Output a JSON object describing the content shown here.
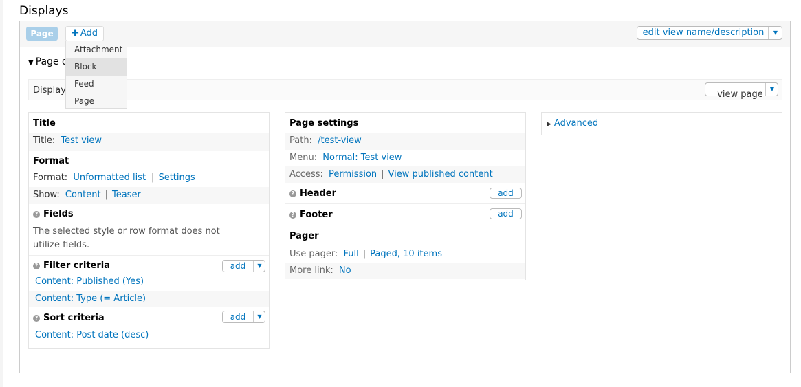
{
  "page": {
    "title": "Displays"
  },
  "tabs": {
    "page_label": "Page",
    "add_label": "Add"
  },
  "add_menu": {
    "items": [
      "Attachment",
      "Block",
      "Feed",
      "Page"
    ]
  },
  "edit_button": {
    "label": "edit view name/description"
  },
  "section": {
    "title": "Page d"
  },
  "display_bar": {
    "label": "Display",
    "view_page_label": "view page"
  },
  "left": {
    "title_heading": "Title",
    "title_label": "Title:",
    "title_value": "Test view",
    "format_heading": "Format",
    "format_label": "Format:",
    "format_value": "Unformatted list",
    "format_settings": "Settings",
    "show_label": "Show:",
    "show_value": "Content",
    "show_teaser": "Teaser",
    "fields_heading": "Fields",
    "fields_text": "The selected style or row format does not utilize fields.",
    "filter_heading": "Filter criteria",
    "filter_add": "add",
    "filter_items": [
      "Content: Published (Yes)",
      "Content: Type (= Article)"
    ],
    "sort_heading": "Sort criteria",
    "sort_add": "add",
    "sort_items": [
      "Content: Post date (desc)"
    ]
  },
  "middle": {
    "heading": "Page settings",
    "path_label": "Path:",
    "path_value": "/test-view",
    "menu_label": "Menu:",
    "menu_value": "Normal: Test view",
    "access_label": "Access:",
    "access_value": "Permission",
    "access_value2": "View published content",
    "header_heading": "Header",
    "header_add": "add",
    "footer_heading": "Footer",
    "footer_add": "add",
    "pager_heading": "Pager",
    "pager_label": "Use pager:",
    "pager_value": "Full",
    "pager_value2": "Paged, 10 items",
    "more_label": "More link:",
    "more_value": "No"
  },
  "right": {
    "advanced_label": "Advanced"
  },
  "colors": {
    "link": "#0074bd",
    "tab_active": "#a9cfe9"
  }
}
